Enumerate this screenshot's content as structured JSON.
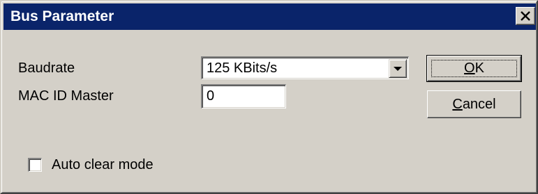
{
  "window": {
    "title": "Bus Parameter",
    "close_glyph": "✕"
  },
  "form": {
    "baudrate_label": "Baudrate",
    "baudrate_value": "125 KBits/s",
    "mac_id_label": "MAC ID Master",
    "mac_id_value": "0",
    "auto_clear_label": "Auto clear mode",
    "auto_clear_checked": false
  },
  "buttons": {
    "ok_mnemonic": "O",
    "ok_rest": "K",
    "cancel_mnemonic": "C",
    "cancel_rest": "ancel"
  },
  "icons": {
    "close": "close-icon",
    "dropdown": "chevron-down-icon"
  }
}
